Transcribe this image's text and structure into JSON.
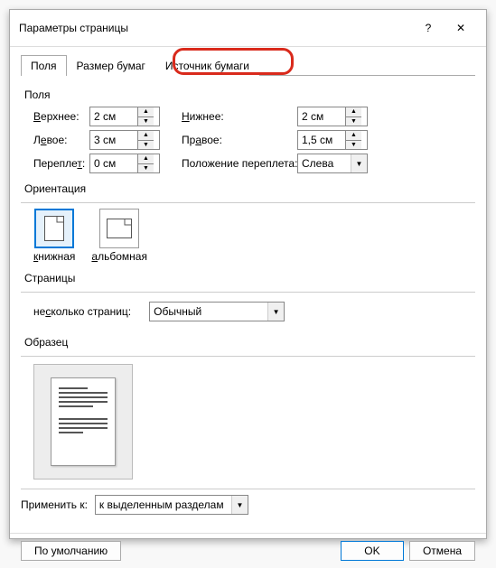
{
  "dialog": {
    "title": "Параметры страницы",
    "help_icon": "?",
    "close_icon": "✕"
  },
  "tabs": {
    "items": [
      "Поля",
      "Размер бумаг",
      "Источник бумаги"
    ],
    "active_index": 0,
    "highlight_index": 2
  },
  "margins": {
    "section_label": "Поля",
    "top_label": "Верхнее:",
    "top_value": "2 см",
    "bottom_label": "Нижнее:",
    "bottom_value": "2 см",
    "left_label": "Левое:",
    "left_value": "3 см",
    "right_label": "Правое:",
    "right_value": "1,5 см",
    "gutter_label": "Переплет:",
    "gutter_value": "0 см",
    "gutter_pos_label": "Положение переплета:",
    "gutter_pos_value": "Слева"
  },
  "orientation": {
    "section_label": "Ориентация",
    "portrait_label": "книжная",
    "landscape_label": "альбомная",
    "selected": "portrait"
  },
  "pages": {
    "section_label": "Страницы",
    "multiple_label": "несколько страниц:",
    "multiple_value": "Обычный"
  },
  "preview": {
    "section_label": "Образец"
  },
  "apply": {
    "label": "Применить к:",
    "value": "к выделенным разделам"
  },
  "buttons": {
    "default": "По умолчанию",
    "ok": "OK",
    "cancel": "Отмена"
  }
}
